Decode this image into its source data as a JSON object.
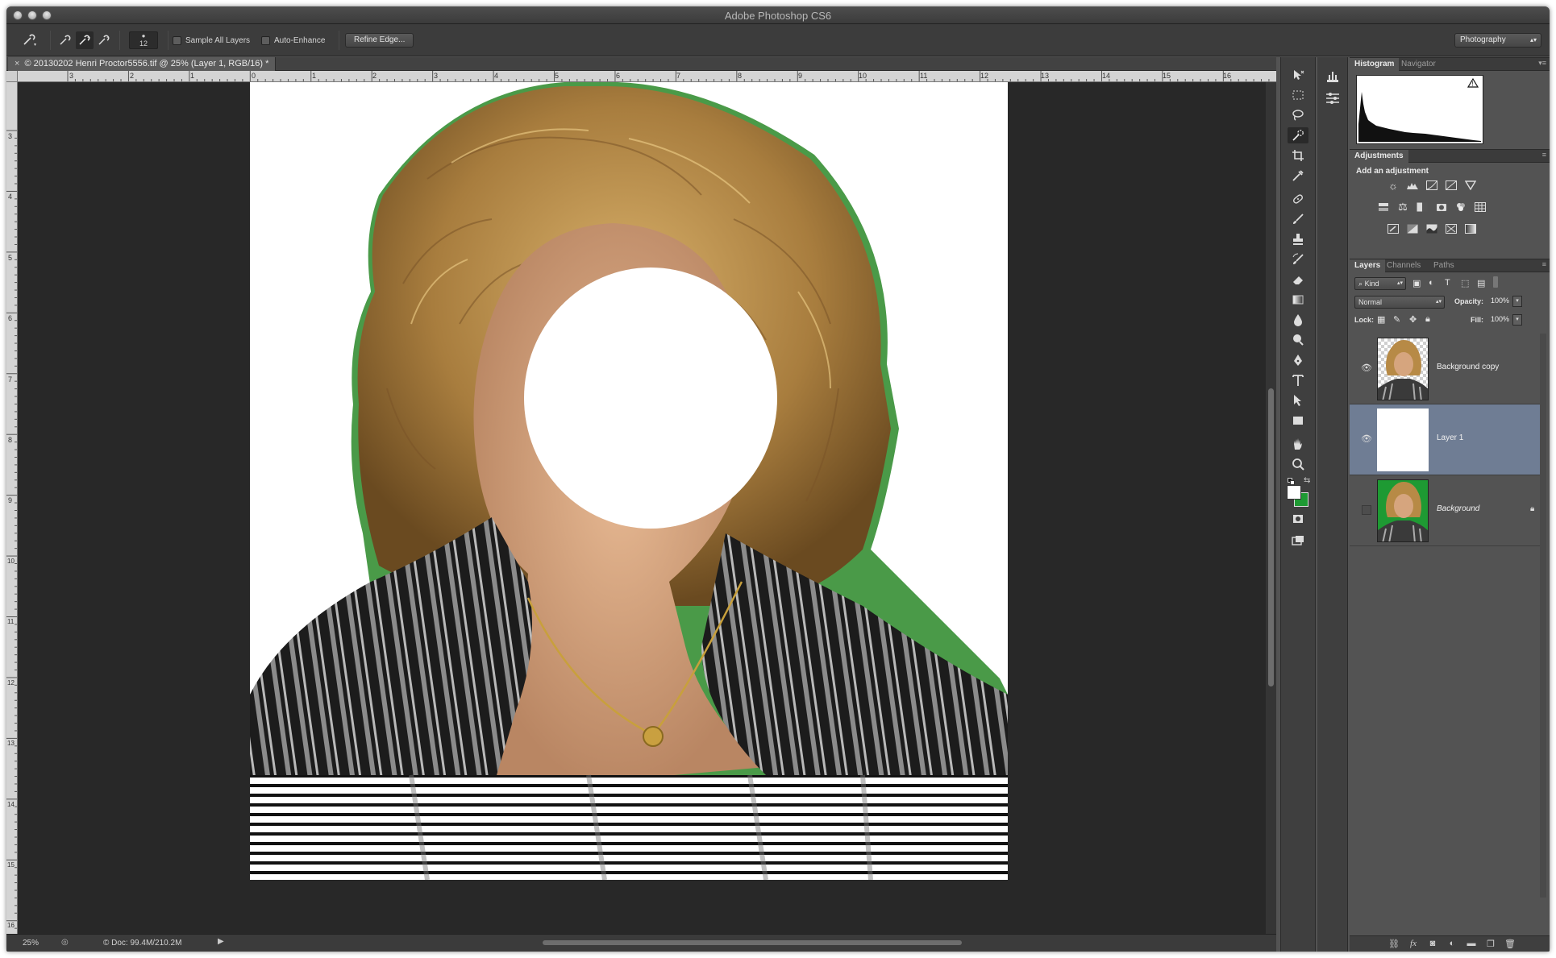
{
  "app": {
    "title": "Adobe Photoshop CS6"
  },
  "options_bar": {
    "brush_size": "12",
    "sample_all_layers": "Sample All Layers",
    "auto_enhance": "Auto-Enhance",
    "refine_edge": "Refine Edge...",
    "workspace": "Photography"
  },
  "document": {
    "tab_title": "© 20130202 Henri Proctor5556.tif @ 25% (Layer 1, RGB/16) *",
    "zoom": "25%",
    "doc_info": "© Doc: 99.4M/210.2M"
  },
  "rulers": {
    "horizontal": [
      "3",
      "2",
      "1",
      "0",
      "1",
      "2",
      "3",
      "4",
      "5",
      "6",
      "7",
      "8",
      "9",
      "10",
      "11",
      "12",
      "13",
      "14",
      "15",
      "16"
    ],
    "vertical": [
      "3",
      "4",
      "5",
      "6",
      "7",
      "8",
      "9",
      "10",
      "11",
      "12",
      "13",
      "14",
      "15",
      "16"
    ]
  },
  "panels": {
    "histogram_tab": "Histogram",
    "navigator_tab": "Navigator",
    "adjustments_tab": "Adjustments",
    "add_adjustment": "Add an adjustment",
    "layers_tab": "Layers",
    "channels_tab": "Channels",
    "paths_tab": "Paths",
    "kind_filter": "Kind",
    "blend_mode": "Normal",
    "opacity_label": "Opacity:",
    "opacity_value": "100%",
    "lock_label": "Lock:",
    "fill_label": "Fill:",
    "fill_value": "100%"
  },
  "layers": [
    {
      "name": "Background copy",
      "visible": true,
      "selected": false,
      "locked": false
    },
    {
      "name": "Layer 1",
      "visible": true,
      "selected": true,
      "locked": false
    },
    {
      "name": "Background",
      "visible": false,
      "selected": false,
      "locked": true
    }
  ],
  "colors": {
    "background_green": "#1e9a33",
    "selection": "#6f7d94",
    "canvas_bg": "#282828"
  },
  "icons": {
    "tools": [
      "move-icon",
      "marquee-icon",
      "lasso-icon",
      "quick-selection-icon",
      "crop-icon",
      "eyedropper-icon",
      "healing-icon",
      "brush-icon",
      "stamp-icon",
      "history-brush-icon",
      "eraser-icon",
      "gradient-icon",
      "blur-icon",
      "dodge-icon",
      "pen-icon",
      "type-icon",
      "path-select-icon",
      "shape-icon",
      "hand-icon",
      "zoom-icon"
    ]
  }
}
